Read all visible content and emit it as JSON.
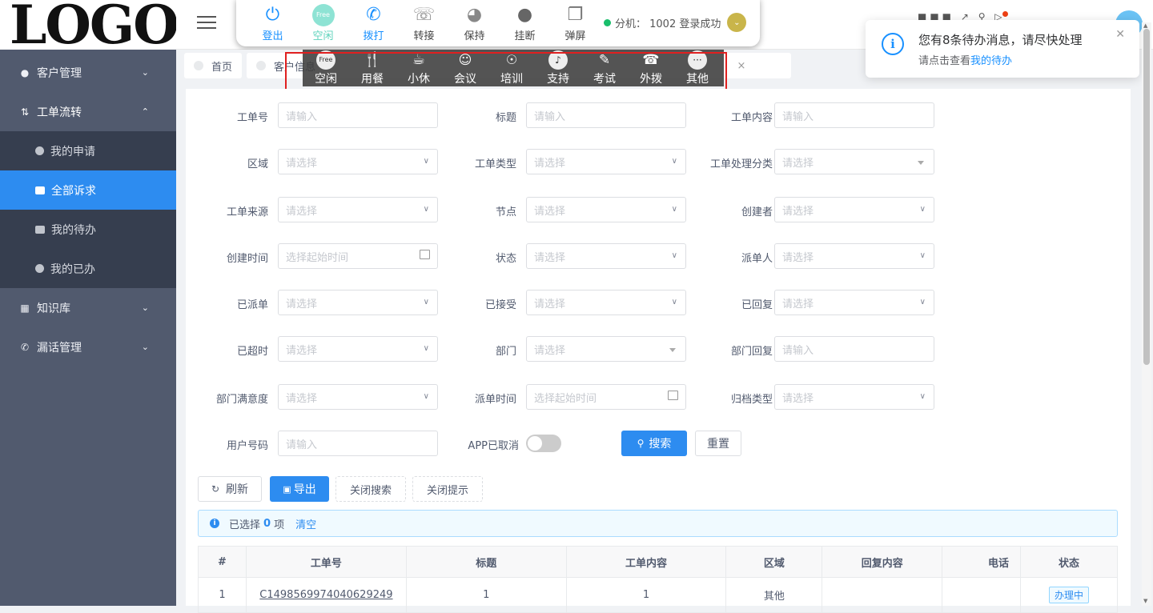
{
  "sidebar": {
    "logo": "LOGO",
    "menu": [
      {
        "label": "客户管理",
        "icon": "users-icon"
      },
      {
        "label": "工单流转",
        "icon": "workflow-icon"
      },
      {
        "label": "知识库",
        "icon": "book-icon"
      },
      {
        "label": "漏话管理",
        "icon": "phone-icon"
      }
    ],
    "submenu": [
      {
        "label": "我的申请"
      },
      {
        "label": "全部诉求"
      },
      {
        "label": "我的待办"
      },
      {
        "label": "我的已办"
      }
    ]
  },
  "cti": {
    "buttons": [
      {
        "label": "登出",
        "icon": "power-icon"
      },
      {
        "label": "空闲",
        "icon": "idle-icon",
        "icon_text": "Free"
      },
      {
        "label": "拨打",
        "icon": "phone-icon"
      },
      {
        "label": "转接",
        "icon": "transfer-icon"
      },
      {
        "label": "保持",
        "icon": "headset-icon"
      },
      {
        "label": "挂断",
        "icon": "hangup-icon"
      },
      {
        "label": "弹屏",
        "icon": "popup-screen-icon"
      }
    ],
    "status": "分机： 1002 登录成功"
  },
  "status_popup": {
    "items": [
      {
        "label": "空闲",
        "icon": "free-icon",
        "icon_text": "Free"
      },
      {
        "label": "用餐",
        "icon": "fork-knife-icon"
      },
      {
        "label": "小休",
        "icon": "coffee-icon"
      },
      {
        "label": "会议",
        "icon": "meeting-icon"
      },
      {
        "label": "培训",
        "icon": "training-icon"
      },
      {
        "label": "支持",
        "icon": "support-icon"
      },
      {
        "label": "考试",
        "icon": "exam-icon"
      },
      {
        "label": "外拨",
        "icon": "outbound-icon"
      },
      {
        "label": "其他",
        "icon": "more-icon"
      }
    ]
  },
  "tabs": [
    {
      "label": "首页"
    },
    {
      "label": "客户信息"
    }
  ],
  "notification": {
    "title": "您有8条待办消息，请尽快处理",
    "desc_prefix": "请点击查看",
    "link": "我的待办"
  },
  "form": {
    "fields": [
      {
        "label": "工单号",
        "placeholder": "请输入"
      },
      {
        "label": "标题",
        "placeholder": "请输入"
      },
      {
        "label": "工单内容",
        "placeholder": "请输入"
      },
      {
        "label": "区域",
        "placeholder": "请选择"
      },
      {
        "label": "工单类型",
        "placeholder": "请选择"
      },
      {
        "label": "工单处理分类",
        "placeholder": "请选择"
      },
      {
        "label": "工单来源",
        "placeholder": "请选择"
      },
      {
        "label": "节点",
        "placeholder": "请选择"
      },
      {
        "label": "创建者",
        "placeholder": "请选择"
      },
      {
        "label": "创建时间",
        "placeholder": "选择起始时间"
      },
      {
        "label": "状态",
        "placeholder": "请选择"
      },
      {
        "label": "派单人",
        "placeholder": "请选择"
      },
      {
        "label": "已派单",
        "placeholder": "请选择"
      },
      {
        "label": "已接受",
        "placeholder": "请选择"
      },
      {
        "label": "已回复",
        "placeholder": "请选择"
      },
      {
        "label": "已超时",
        "placeholder": "请选择"
      },
      {
        "label": "部门",
        "placeholder": "请选择"
      },
      {
        "label": "部门回复",
        "placeholder": "请输入"
      },
      {
        "label": "部门满意度",
        "placeholder": "请选择"
      },
      {
        "label": "派单时间",
        "placeholder": "选择起始时间"
      },
      {
        "label": "归档类型",
        "placeholder": "请选择"
      },
      {
        "label": "用户号码",
        "placeholder": "请输入"
      }
    ],
    "app_cancel_label": "APP已取消",
    "app_cancel_on": false,
    "search_label": "搜索",
    "reset_label": "重置"
  },
  "toolbar": {
    "refresh": "刷新",
    "export": "导出",
    "close_search": "关闭搜索",
    "close_tip": "关闭提示"
  },
  "selection": {
    "prefix": "已选择",
    "count": "0",
    "suffix": "项",
    "clear": "清空"
  },
  "table": {
    "columns": [
      "#",
      "工单号",
      "标题",
      "工单内容",
      "区域",
      "回复内容",
      "电话",
      "状态"
    ],
    "rows": [
      {
        "index": "1",
        "id": "C1498569974040629249",
        "title": "1",
        "content": "1",
        "area": "其他",
        "reply": "",
        "phone": "",
        "status": "办理中"
      }
    ]
  },
  "colors": {
    "accent": "#2d8cf0",
    "sidebar_bg": "#515a6e",
    "submenu_bg": "#363e4f",
    "highlight_border": "#e02020"
  }
}
